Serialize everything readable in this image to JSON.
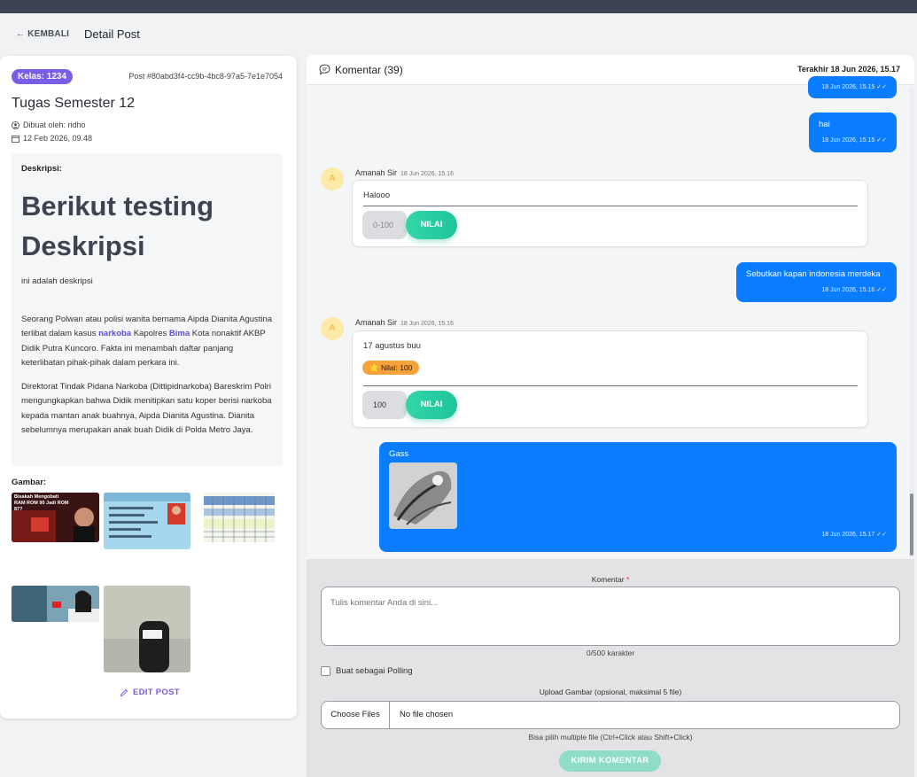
{
  "nav": {
    "back_label": "← KEMBALI",
    "page_title": "Detail Post"
  },
  "post": {
    "kelas_badge": "Kelas: 1234",
    "post_id": "Post #80abd3f4-cc9b-4bc8-97a5-7e1e7054",
    "title": "Tugas Semester 12",
    "created_by": "Dibuat oleh: ridho",
    "created_at": "12 Feb 2026, 09.48",
    "description_label": "Deskripsi:",
    "description_heading": "Berikut testing Deskripsi",
    "description_small": "ini adalah deskripsi",
    "para1": {
      "a": "Seorang Polwan atau polisi wanita bernama Aipda Dianita Agustina terlibat dalam kasus ",
      "kw1": "narkoba",
      "b": " Kapolres ",
      "kw2": "Bima",
      "c": " Kota nonaktif AKBP Didik Putra Kuncoro. Fakta ini menambah daftar panjang keterlibatan pihak-pihak dalam perkara ini."
    },
    "para2": "Direktorat Tindak Pidana Narkoba (Dittipidnarkoba) Bareskrim Polri mengungkapkan bahwa Didik menitipkan satu koper berisi narkoba kepada mantan anak buahnya, Aipda Dianita Agustina. Dianita sebelumnya merupakan anak buah Didik di Polda Metro Jaya.",
    "images_label": "Gambar:",
    "thumb1_text": "Bisakah Mengobati RAM ROM 90 Jadi ROM 87?",
    "edit_label": "EDIT POST"
  },
  "comments": {
    "title": "Komentar (39)",
    "last_update": "Terakhir 18 Jun 2026, 15.17",
    "msg_top_time": "18 Jun 2026, 15.15 ✓✓",
    "msg_hai": {
      "text": "hai",
      "time": "18 Jun 2026, 15.15 ✓✓"
    },
    "c1": {
      "avatar": "A",
      "author": "Amanah Sir",
      "time": "18 Jun 2026, 15.16",
      "text": "Halooo",
      "score_placeholder": "0-100",
      "nilai_label": "NILAI"
    },
    "msg_merdeka": {
      "text": "Sebutkan kapan indonesia merdeka",
      "time": "18 Jun 2026, 15.16 ✓✓"
    },
    "c2": {
      "avatar": "A",
      "author": "Amanah Sir",
      "time": "18 Jun 2026, 15.16",
      "text": "17 agustus buu",
      "badge": "⭐ Nilai: 100",
      "score_value": "100",
      "nilai_label": "NILAI"
    },
    "msg_gass": {
      "text": "Gass",
      "time": "18 Jun 2026, 15.17 ✓✓"
    }
  },
  "form": {
    "comment_label": "Komentar",
    "required_mark": "*",
    "placeholder": "Tulis komentar Anda di sini...",
    "char_count": "0/500 karakter",
    "poll_label": "Buat sebagai Polling",
    "upload_label": "Upload Gambar (opsional, maksimal 5 file)",
    "choose_files": "Choose Files",
    "no_file": "No file chosen",
    "file_hint": "Bisa pilih multiple file (Ctrl+Click atau Shift+Click)",
    "submit_label": "KIRIM KOMENTAR"
  },
  "colors": {
    "accent_purple": "#7b5ce6",
    "bubble_blue": "#0a7cff",
    "nilai_green": "#1fc49c",
    "badge_orange": "#f7a23b"
  }
}
